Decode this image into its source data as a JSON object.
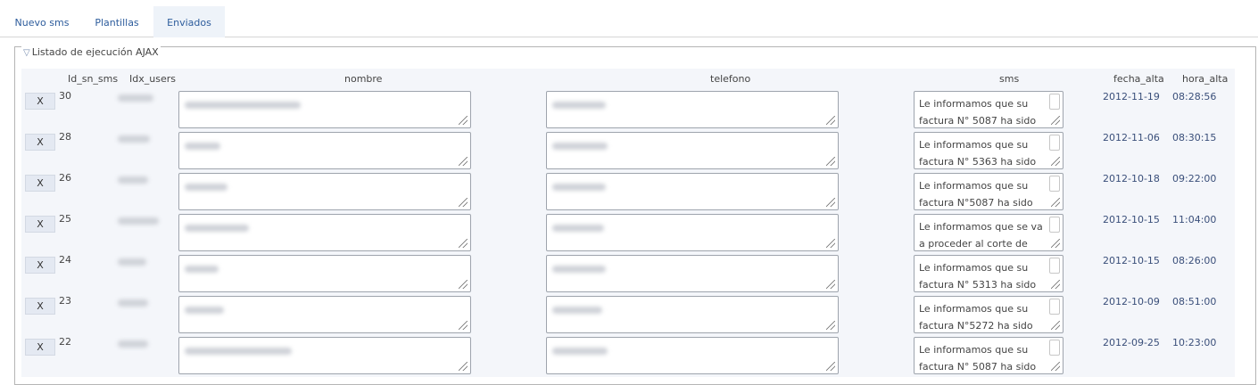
{
  "tabs": [
    {
      "label": "Nuevo sms",
      "active": false
    },
    {
      "label": "Plantillas",
      "active": false
    },
    {
      "label": "Enviados",
      "active": true
    }
  ],
  "section": {
    "title": "Listado de ejecución AJAX",
    "collapse_glyph": "▽"
  },
  "columns": {
    "id": "Id_sn_sms",
    "users": "Idx_users",
    "nombre": "nombre",
    "telefono": "telefono",
    "sms": "sms",
    "fecha": "fecha_alta",
    "hora": "hora_alta"
  },
  "delete_label": "X",
  "rows": [
    {
      "id": "30",
      "sms_line1": "Le informamos que su",
      "sms_line2": "factura N° 5087 ha sido",
      "fecha": "2012-11-19",
      "hora": "08:28:56"
    },
    {
      "id": "28",
      "sms_line1": "Le informamos que su",
      "sms_line2": "factura N° 5363 ha sido",
      "fecha": "2012-11-06",
      "hora": "08:30:15"
    },
    {
      "id": "26",
      "sms_line1": "Le informamos que su",
      "sms_line2": "factura N°5087 ha sido",
      "fecha": "2012-10-18",
      "hora": "09:22:00"
    },
    {
      "id": "25",
      "sms_line1": "Le informamos que se va",
      "sms_line2": "a proceder al corte de",
      "fecha": "2012-10-15",
      "hora": "11:04:00"
    },
    {
      "id": "24",
      "sms_line1": "Le informamos que su",
      "sms_line2": "factura N° 5313 ha sido",
      "fecha": "2012-10-15",
      "hora": "08:26:00"
    },
    {
      "id": "23",
      "sms_line1": "Le informamos que su",
      "sms_line2": "factura N°5272 ha sido",
      "fecha": "2012-10-09",
      "hora": "08:51:00"
    },
    {
      "id": "22",
      "sms_line1": "Le informamos que su",
      "sms_line2": "factura N° 5087 ha sido",
      "fecha": "2012-09-25",
      "hora": "10:23:00"
    }
  ]
}
